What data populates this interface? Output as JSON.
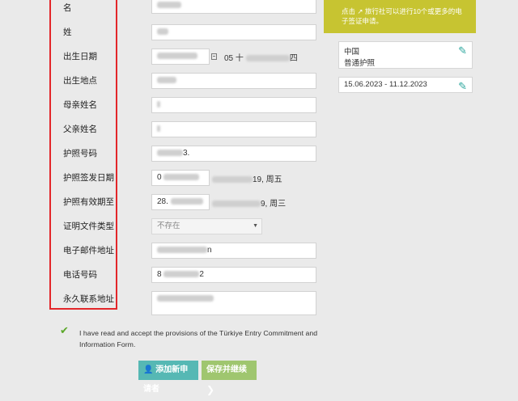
{
  "form": {
    "rows": [
      {
        "label": "名",
        "value": ""
      },
      {
        "label": "姓",
        "value": ""
      },
      {
        "label": "出生日期",
        "value": "05 十",
        "suffix": "四"
      },
      {
        "label": "出生地点",
        "value": ""
      },
      {
        "label": "母亲姓名",
        "value": ""
      },
      {
        "label": "父亲姓名",
        "value": ""
      },
      {
        "label": "护照号码",
        "value": "",
        "suffix": "3."
      },
      {
        "label": "护照签发日期",
        "value": "0",
        "suffix": "19, 周五"
      },
      {
        "label": "护照有效期至",
        "value": "28.",
        "suffix": "9, 周三"
      },
      {
        "label": "证明文件类型",
        "value": "不存在"
      },
      {
        "label": "电子邮件地址",
        "value": "",
        "suffix": "n"
      },
      {
        "label": "电话号码",
        "value": "8",
        "suffix": "2"
      },
      {
        "label": "永久联系地址",
        "value": ""
      }
    ]
  },
  "sidebar": {
    "banner_text": "点击 ↗ 旅行社可以进行10个或更多的电子签证申请。",
    "card1_line1": "中国",
    "card1_line2": "普通护照",
    "card2_text": "15.06.2023 - 11.12.2023"
  },
  "agreement": {
    "checked": true,
    "text": "I have read and accept the provisions of the Türkiye Entry Commitment and Information Form."
  },
  "buttons": {
    "add_label": "添加新申请者",
    "save_label": "保存并继续"
  },
  "colors": {
    "highlight_box": "#e3262a",
    "banner_bg": "#c7c431",
    "add_button": "#56b8b4",
    "save_button": "#9fc66f",
    "check": "#5ba82a"
  }
}
